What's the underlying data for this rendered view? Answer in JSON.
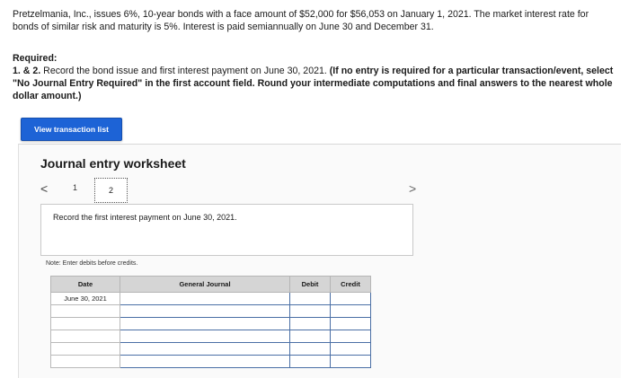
{
  "problem": {
    "text": "Pretzelmania, Inc., issues 6%, 10-year bonds with a face amount of $52,000 for $56,053 on January 1, 2021. The market interest rate for bonds of similar risk and maturity is 5%. Interest is paid semiannually on June 30 and December 31."
  },
  "required": {
    "title": "Required:",
    "lead": "1. & 2.",
    "text": " Record the bond issue and first interest payment on June 30, 2021. ",
    "bold_text": "(If no entry is required for a particular transaction/event, select \"No Journal Entry Required\" in the first account field. Round your intermediate computations and final answers to the nearest whole dollar amount.)"
  },
  "view_button": {
    "label": "View transaction list"
  },
  "worksheet": {
    "title": "Journal entry worksheet",
    "nav_prev": "<",
    "nav_next": ">",
    "tabs": [
      "1",
      "2"
    ],
    "active_tab": 2,
    "instruction": "Record the first interest payment on June 30, 2021.",
    "note": "Note: Enter debits before credits."
  },
  "journal": {
    "headers": [
      "Date",
      "General Journal",
      "Debit",
      "Credit"
    ],
    "rows": [
      {
        "date": "June 30, 2021"
      },
      {
        "date": ""
      },
      {
        "date": ""
      },
      {
        "date": ""
      },
      {
        "date": ""
      },
      {
        "date": ""
      }
    ]
  },
  "colors": {
    "button_blue": "#1d63d6",
    "header_gray": "#d5d5d5",
    "input_border": "#4a6fa5"
  }
}
